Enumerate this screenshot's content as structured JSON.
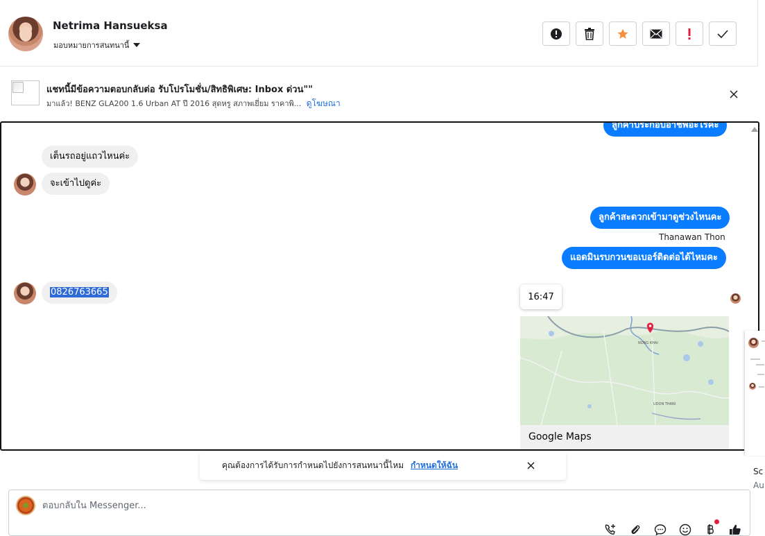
{
  "header": {
    "user_name": "Netrima Hansueksa",
    "assign_label": "มอบหมายการสนทนานี้",
    "actions": [
      {
        "name": "report-button",
        "icon": "alert-circle-icon"
      },
      {
        "name": "delete-button",
        "icon": "trash-icon"
      },
      {
        "name": "star-button",
        "icon": "star-icon"
      },
      {
        "name": "mark-unread-button",
        "icon": "envelope-icon"
      },
      {
        "name": "priority-button",
        "icon": "exclamation-icon"
      },
      {
        "name": "done-button",
        "icon": "check-icon"
      }
    ]
  },
  "ad": {
    "title": "แชทนี้มีข้อความตอบกลับต่อ รับโปรโมชั่น/สิทธิพิเศษ: Inbox ด่วน\"\"",
    "subtitle": "มาแล้ว! BENZ GLA200 1.6 Urban AT ปี 2016 สุดหรู สภาพเยี่ยม ราคาพิ...",
    "link": "ดูโฆษณา"
  },
  "messages": {
    "top_partial": "ลูกค้าประกอบอาชีพอะไรคะ",
    "in_1": "เต็นรถอยู่แถวไหนค่ะ",
    "in_2": "จะเข้าไปดูค่ะ",
    "out_1": "ลูกค้าสะดวกเข้ามาดูช่วงไหนคะ",
    "sender": "Thanawan Thon",
    "out_2": "แอดมินรบกวนขอเบอร์ติดต่อได้ไหมคะ",
    "in_3": "0826763665",
    "time": "16:47",
    "map_label": "Google Maps",
    "map_place_1": "NONG KHAI",
    "map_place_2": "UDON THANI"
  },
  "prompt": {
    "text": "คุณต้องการได้รับการกำหนดไปยังการสนทนานี้ไหม",
    "link": "กำหนดให้ฉัน"
  },
  "composer": {
    "placeholder": "ตอบกลับใน Messenger..."
  },
  "side": {
    "line_1": "Sc",
    "line_2": "Au"
  },
  "colors": {
    "accent": "#0a7cff",
    "link": "#216fdb",
    "star": "#f7923b",
    "priority": "#e41e3f"
  }
}
